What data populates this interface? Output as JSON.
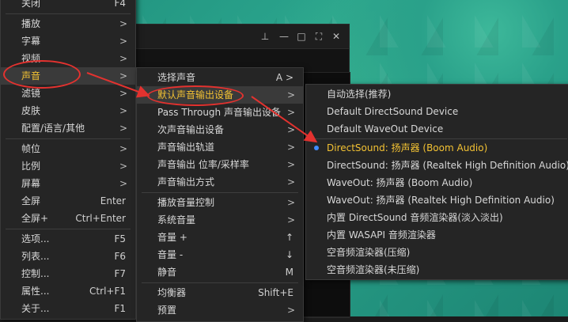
{
  "main_menu": {
    "items": [
      {
        "label": "关闭",
        "shortcut": "F4"
      },
      {
        "label": "播放",
        "arrow": ">"
      },
      {
        "label": "字幕",
        "arrow": ">"
      },
      {
        "label": "视频",
        "arrow": ">"
      },
      {
        "label": "声音",
        "arrow": ">"
      },
      {
        "label": "滤镜",
        "arrow": ">"
      },
      {
        "label": "皮肤",
        "arrow": ">"
      },
      {
        "label": "配置/语言/其他",
        "arrow": ">"
      },
      {
        "label": "帧位",
        "arrow": ">"
      },
      {
        "label": "比例",
        "arrow": ">"
      },
      {
        "label": "屏幕",
        "arrow": ">"
      },
      {
        "label": "全屏",
        "shortcut": "Enter"
      },
      {
        "label": "全屏+",
        "shortcut": "Ctrl+Enter"
      },
      {
        "label": "选项...",
        "shortcut": "F5"
      },
      {
        "label": "列表...",
        "shortcut": "F6"
      },
      {
        "label": "控制...",
        "shortcut": "F7"
      },
      {
        "label": "属性...",
        "shortcut": "Ctrl+F1"
      },
      {
        "label": "关于...",
        "shortcut": "F1"
      }
    ]
  },
  "sound_menu": {
    "items": [
      {
        "label": "选择声音",
        "shortcut": "A >"
      },
      {
        "label": "默认声音输出设备",
        "arrow": ">"
      },
      {
        "label": "Pass Through 声音输出设备",
        "arrow": ">"
      },
      {
        "label": "次声音输出设备",
        "arrow": ">"
      },
      {
        "label": "声音输出轨道",
        "arrow": ">"
      },
      {
        "label": "声音输出 位率/采样率",
        "arrow": ">"
      },
      {
        "label": "声音输出方式",
        "arrow": ">"
      },
      {
        "label": "播放音量控制",
        "arrow": ">"
      },
      {
        "label": "系统音量",
        "arrow": ">"
      },
      {
        "label": "音量 +",
        "shortcut": "↑"
      },
      {
        "label": "音量 -",
        "shortcut": "↓"
      },
      {
        "label": "静音",
        "shortcut": "M"
      },
      {
        "label": "均衡器",
        "shortcut": "Shift+E"
      },
      {
        "label": "预置",
        "arrow": ">"
      }
    ]
  },
  "device_menu": {
    "items": [
      {
        "label": "自动选择(推荐)"
      },
      {
        "label": "Default DirectSound Device"
      },
      {
        "label": "Default WaveOut Device"
      },
      {
        "label": "DirectSound: 扬声器 (Boom Audio)"
      },
      {
        "label": "DirectSound: 扬声器 (Realtek High Definition Audio)"
      },
      {
        "label": "WaveOut: 扬声器 (Boom Audio)"
      },
      {
        "label": "WaveOut: 扬声器 (Realtek High Definition Audio)"
      },
      {
        "label": "内置 DirectSound 音频渲染器(淡入淡出)"
      },
      {
        "label": "内置 WASAPI 音频渲染器"
      },
      {
        "label": "空音频渲染器(压缩)"
      },
      {
        "label": "空音频渲染器(未压缩)"
      }
    ],
    "selected": "DirectSound: 扬声器 (Boom Audio)"
  },
  "player_controls": {
    "pin": "⊥",
    "min": "—",
    "max": "□",
    "full": "⛶",
    "close": "✕"
  },
  "colors": {
    "active_text": "#f3c233",
    "annotation": "#e3322f",
    "selected_dot": "#3f8cff"
  }
}
